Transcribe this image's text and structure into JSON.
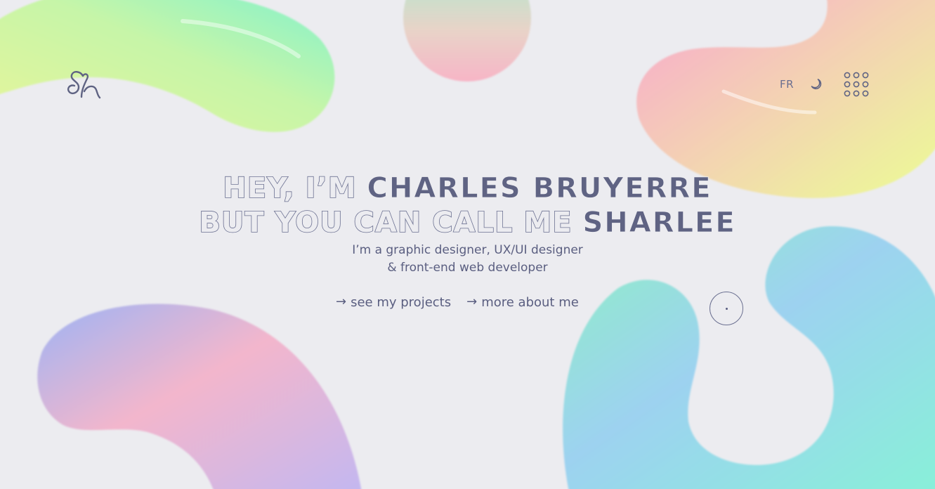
{
  "header": {
    "language_toggle": "FR",
    "theme_toggle_icon": "moon-icon",
    "menu_icon": "grid-dots-icon",
    "logo_icon": "sh-monogram-icon"
  },
  "hero": {
    "line1_prefix": "HEY, I’M",
    "line1_name": "CHARLES BRUYERRE",
    "line2_prefix": "BUT YOU CAN CALL ME",
    "line2_name": "SHARLEE",
    "subtitle_line1": "I’m a graphic designer, UX/UI designer",
    "subtitle_line2": "& front-end web developer"
  },
  "cta": {
    "projects_label": "see my projects",
    "about_label": "more about me",
    "arrow_glyph": "→"
  },
  "colors": {
    "background": "#ececf0",
    "text": "#5a5e80",
    "outline": "#6a6f90",
    "blob_green": "#7ef0c8",
    "blob_yellow": "#eef58f",
    "blob_pink": "#f7b9c7",
    "blob_blue": "#93bff2",
    "blob_lavender": "#c9bff0"
  }
}
